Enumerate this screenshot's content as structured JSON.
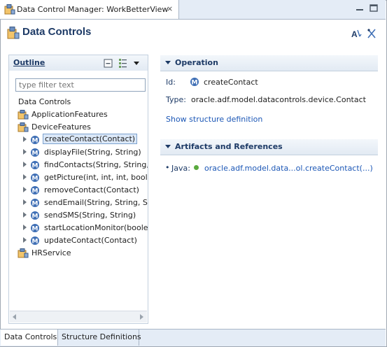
{
  "editor_tab": {
    "title": "Data Control Manager: WorkBetterView",
    "close_glyph": "⨯"
  },
  "header": {
    "title": "Data Controls"
  },
  "outline": {
    "title": "Outline",
    "filter_placeholder": "type filter text",
    "tree": [
      {
        "label": "Data Controls",
        "type": "root"
      },
      {
        "label": "ApplicationFeatures",
        "type": "dc"
      },
      {
        "label": "DeviceFeatures",
        "type": "dc"
      },
      {
        "label": "createContact(Contact)",
        "type": "method",
        "selected": true
      },
      {
        "label": "displayFile(String, String)",
        "type": "method"
      },
      {
        "label": "findContacts(String, String,",
        "type": "method"
      },
      {
        "label": "getPicture(int, int, int, boole",
        "type": "method"
      },
      {
        "label": "removeContact(Contact)",
        "type": "method"
      },
      {
        "label": "sendEmail(String, String, Str",
        "type": "method"
      },
      {
        "label": "sendSMS(String, String)",
        "type": "method"
      },
      {
        "label": "startLocationMonitor(boole",
        "type": "method"
      },
      {
        "label": "updateContact(Contact)",
        "type": "method"
      },
      {
        "label": "HRService",
        "type": "dc"
      }
    ]
  },
  "operation": {
    "title": "Operation",
    "id_label": "Id:",
    "id_value": "createContact",
    "type_label": "Type:",
    "type_value": "oracle.adf.model.datacontrols.device.Contact",
    "link": "Show structure definition"
  },
  "artifacts": {
    "title": "Artifacts and References",
    "bullet": "•",
    "java_label": "Java:",
    "java_link": "oracle.adf.model.data...ol.createContact(...)"
  },
  "bottom_tabs": [
    {
      "label": "Data Controls",
      "active": true
    },
    {
      "label": "Structure Definitions",
      "active": false
    }
  ],
  "colors": {
    "accent": "#1d3a66",
    "link": "#1c57b6",
    "method_icon": "#3f6fb5",
    "tab_bg": "#e4ecf6"
  }
}
